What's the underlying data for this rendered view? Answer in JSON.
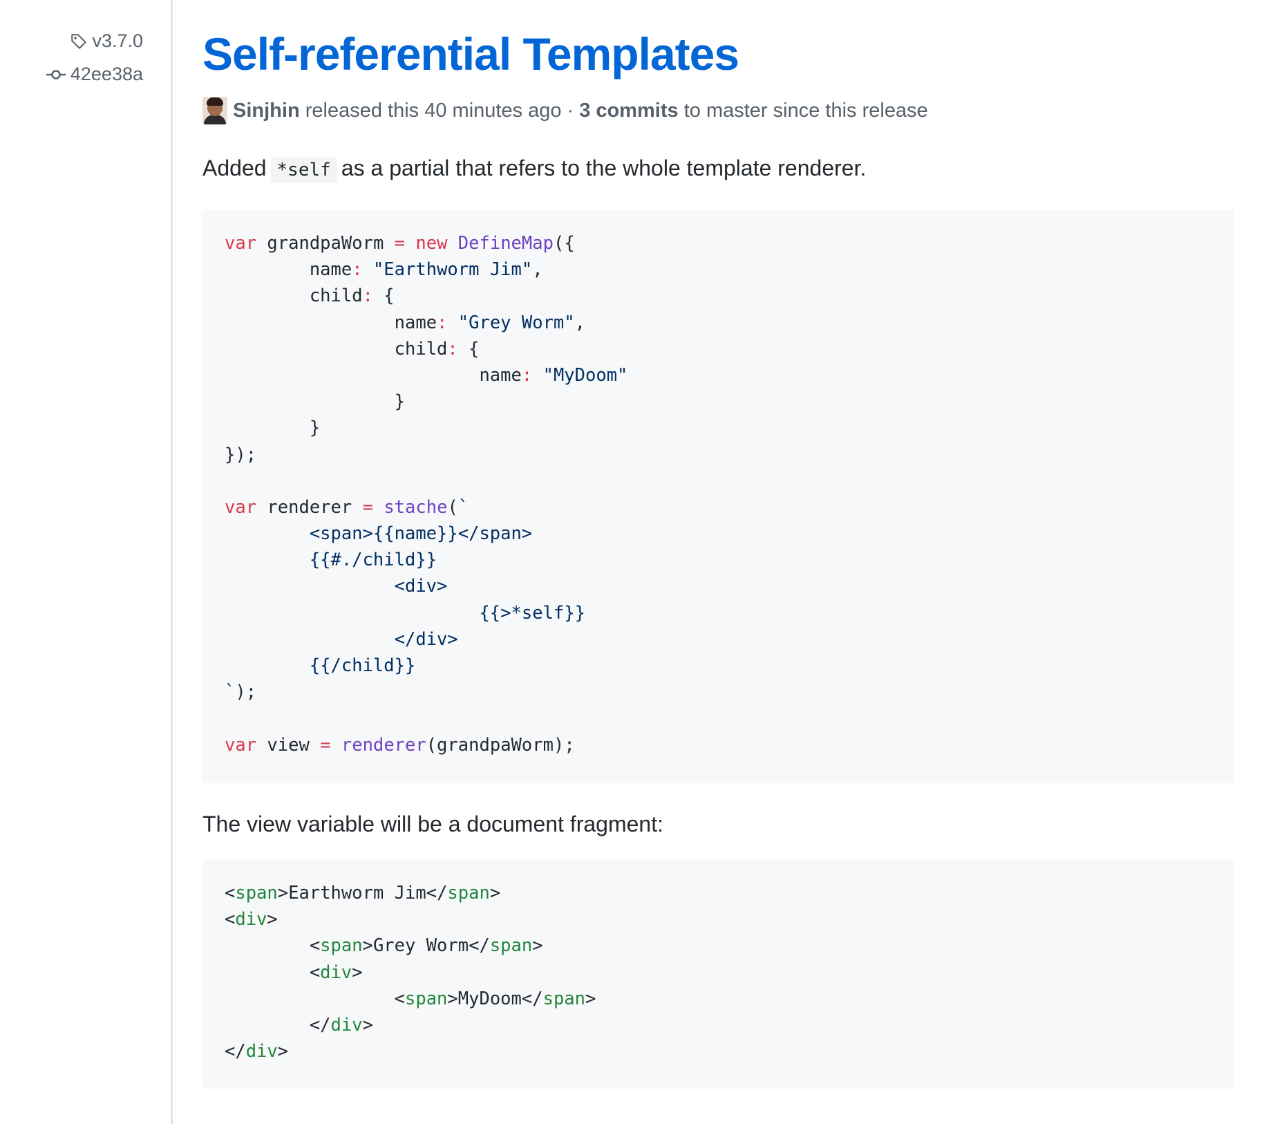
{
  "meta": {
    "tag": "v3.7.0",
    "commit": "42ee38a",
    "tag_icon": "tag-icon",
    "commit_icon": "commit-icon"
  },
  "release": {
    "title": "Self-referential Templates",
    "author": "Sinjhin",
    "released_text": "released this 40 minutes ago",
    "separator": "·",
    "commits_link": "3 commits",
    "commits_suffix": "to master since this release",
    "avatar_icon": "avatar-icon"
  },
  "body": {
    "intro_before": "Added",
    "intro_code": "*self",
    "intro_after": "as a partial that refers to the whole template renderer.",
    "paragraph2": "The view variable will be a document fragment:"
  },
  "colors": {
    "link": "#0366d6",
    "keyword": "#d73a49",
    "function": "#6f42c1",
    "string": "#032f62",
    "tag": "#22863a",
    "code_background": "#f6f8fa"
  },
  "code_block_1": [
    [
      [
        "kw",
        "var"
      ],
      [
        "pl",
        " grandpaWorm "
      ],
      [
        "kw",
        "="
      ],
      [
        "pl",
        " "
      ],
      [
        "kw",
        "new"
      ],
      [
        "pl",
        " "
      ],
      [
        "fn",
        "DefineMap"
      ],
      [
        "pl",
        "({"
      ]
    ],
    [
      [
        "pl",
        "        name"
      ],
      [
        "kw",
        ":"
      ],
      [
        "pl",
        " "
      ],
      [
        "str",
        "\"Earthworm Jim\""
      ],
      [
        "pl",
        ","
      ]
    ],
    [
      [
        "pl",
        "        child"
      ],
      [
        "kw",
        ":"
      ],
      [
        "pl",
        " {"
      ]
    ],
    [
      [
        "pl",
        "                name"
      ],
      [
        "kw",
        ":"
      ],
      [
        "pl",
        " "
      ],
      [
        "str",
        "\"Grey Worm\""
      ],
      [
        "pl",
        ","
      ]
    ],
    [
      [
        "pl",
        "                child"
      ],
      [
        "kw",
        ":"
      ],
      [
        "pl",
        " {"
      ]
    ],
    [
      [
        "pl",
        "                        name"
      ],
      [
        "kw",
        ":"
      ],
      [
        "pl",
        " "
      ],
      [
        "str",
        "\"MyDoom\""
      ]
    ],
    [
      [
        "pl",
        "                }"
      ]
    ],
    [
      [
        "pl",
        "        }"
      ]
    ],
    [
      [
        "pl",
        "});"
      ]
    ],
    [
      [
        "pl",
        ""
      ]
    ],
    [
      [
        "kw",
        "var"
      ],
      [
        "pl",
        " renderer "
      ],
      [
        "kw",
        "="
      ],
      [
        "pl",
        " "
      ],
      [
        "fn",
        "stache"
      ],
      [
        "pl",
        "("
      ],
      [
        "str",
        "`"
      ]
    ],
    [
      [
        "str",
        "        <span>{{name}}</span>"
      ]
    ],
    [
      [
        "str",
        "        {{#./child}}"
      ]
    ],
    [
      [
        "str",
        "                <div>"
      ]
    ],
    [
      [
        "str",
        "                        {{>*self}}"
      ]
    ],
    [
      [
        "str",
        "                </div>"
      ]
    ],
    [
      [
        "str",
        "        {{/child}}"
      ]
    ],
    [
      [
        "str",
        "`"
      ],
      [
        "pl",
        ");"
      ]
    ],
    [
      [
        "pl",
        ""
      ]
    ],
    [
      [
        "kw",
        "var"
      ],
      [
        "pl",
        " view "
      ],
      [
        "kw",
        "="
      ],
      [
        "pl",
        " "
      ],
      [
        "fn",
        "renderer"
      ],
      [
        "pl",
        "(grandpaWorm);"
      ]
    ]
  ],
  "code_block_2": [
    [
      [
        "pl",
        "<"
      ],
      [
        "tag",
        "span"
      ],
      [
        "pl",
        ">Earthworm Jim</"
      ],
      [
        "tag",
        "span"
      ],
      [
        "pl",
        ">"
      ]
    ],
    [
      [
        "pl",
        "<"
      ],
      [
        "tag",
        "div"
      ],
      [
        "pl",
        ">"
      ]
    ],
    [
      [
        "pl",
        "        <"
      ],
      [
        "tag",
        "span"
      ],
      [
        "pl",
        ">Grey Worm</"
      ],
      [
        "tag",
        "span"
      ],
      [
        "pl",
        ">"
      ]
    ],
    [
      [
        "pl",
        "        <"
      ],
      [
        "tag",
        "div"
      ],
      [
        "pl",
        ">"
      ]
    ],
    [
      [
        "pl",
        "                <"
      ],
      [
        "tag",
        "span"
      ],
      [
        "pl",
        ">MyDoom</"
      ],
      [
        "tag",
        "span"
      ],
      [
        "pl",
        ">"
      ]
    ],
    [
      [
        "pl",
        "        </"
      ],
      [
        "tag",
        "div"
      ],
      [
        "pl",
        ">"
      ]
    ],
    [
      [
        "pl",
        "</"
      ],
      [
        "tag",
        "div"
      ],
      [
        "pl",
        ">"
      ]
    ]
  ]
}
